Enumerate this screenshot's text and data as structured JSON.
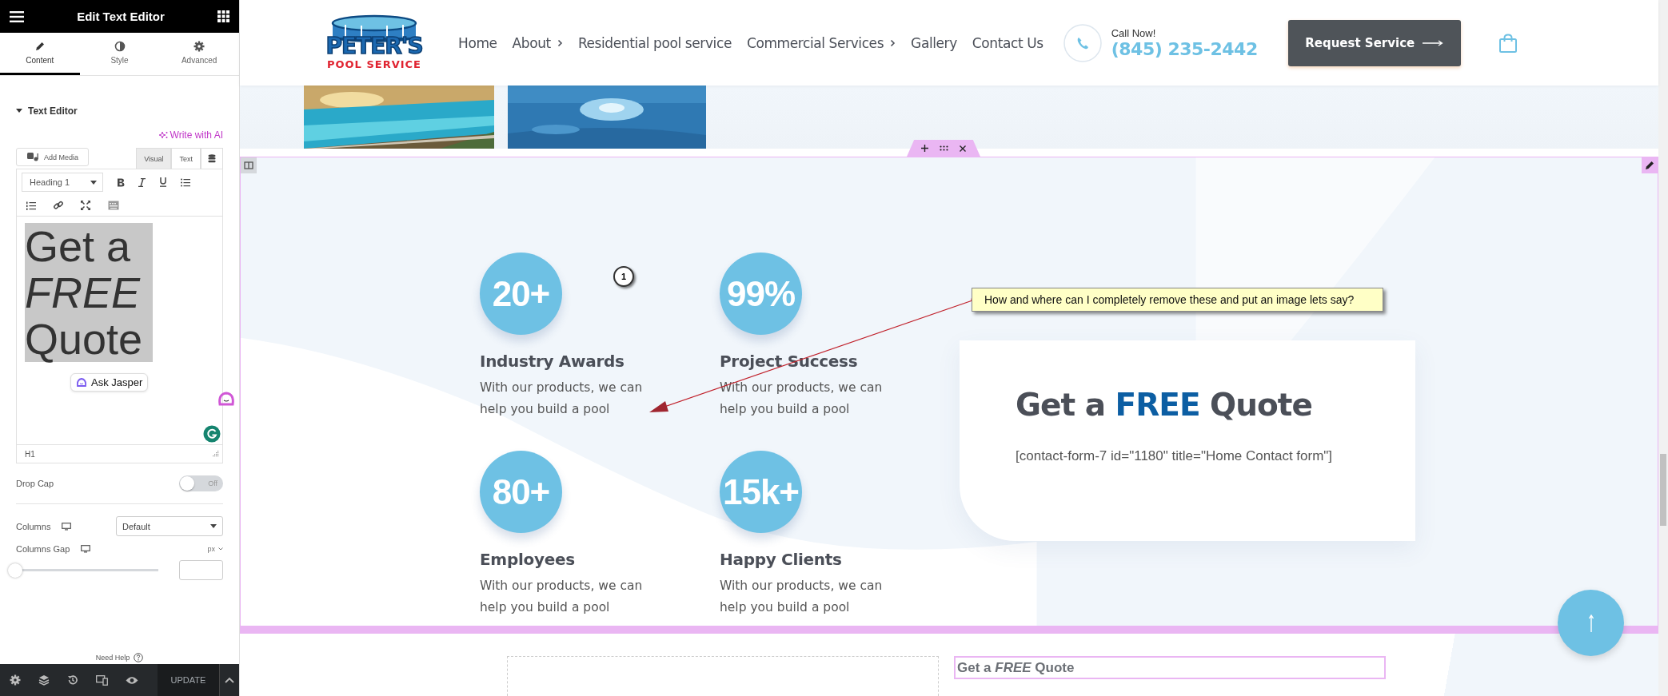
{
  "editor_panel": {
    "title": "Edit Text Editor",
    "tabs": [
      {
        "label": "Content",
        "selected": true
      },
      {
        "label": "Style",
        "selected": false
      },
      {
        "label": "Advanced",
        "selected": false
      }
    ],
    "section_title": "Text Editor",
    "write_ai": "Write with AI",
    "add_media": "Add Media",
    "mode_tabs": [
      {
        "label": "Visual",
        "selected": true
      },
      {
        "label": "Text",
        "selected": false
      }
    ],
    "format": "Heading 1",
    "content": "Get a *FREE* Quote",
    "ask_jasper": "Ask Jasper",
    "path": "H1",
    "drop_cap": {
      "label": "Drop Cap",
      "on": false,
      "state_text": "Off"
    },
    "columns": {
      "label": "Columns",
      "value": "Default"
    },
    "columns_gap": {
      "label": "Columns Gap",
      "unit": "px",
      "level": 0
    },
    "need_help": "Need Help",
    "update": "UPDATE"
  },
  "site": {
    "logo": {
      "line1": "PETER'S",
      "line2": "POOL SERVICE"
    },
    "nav": [
      {
        "label": "Home",
        "submenu": false
      },
      {
        "label": "About",
        "submenu": true
      },
      {
        "label": "Residential pool service",
        "submenu": false
      },
      {
        "label": "Commercial Services",
        "submenu": true
      },
      {
        "label": "Gallery",
        "submenu": false
      },
      {
        "label": "Contact Us",
        "submenu": false
      }
    ],
    "call": {
      "label": "Call Now!",
      "phone": "(845) 235-2442"
    },
    "cta": "Request Service",
    "stats": [
      {
        "value": "20+",
        "title": "Industry Awards",
        "text": "With our products, we can help you build a pool"
      },
      {
        "value": "99%",
        "title": "Project Success",
        "text": "With our products, we can help you build a pool"
      },
      {
        "value": "80+",
        "title": "Employees",
        "text": "With our products, we can help you build a pool"
      },
      {
        "value": "15k+",
        "title": "Happy Clients",
        "text": "With our products, we can help you build a pool"
      }
    ],
    "quote_card": {
      "before": "Get a",
      "highlight": "FREE",
      "after": "Quote",
      "shortcode": "[contact-form-7 id=\"1180\" title=\"Home Contact form\"]"
    },
    "bottom_heading": "Get a *FREE* Quote"
  },
  "annotation": {
    "number": "1",
    "note": "How and where can I completely remove these and put an image lets say?"
  }
}
